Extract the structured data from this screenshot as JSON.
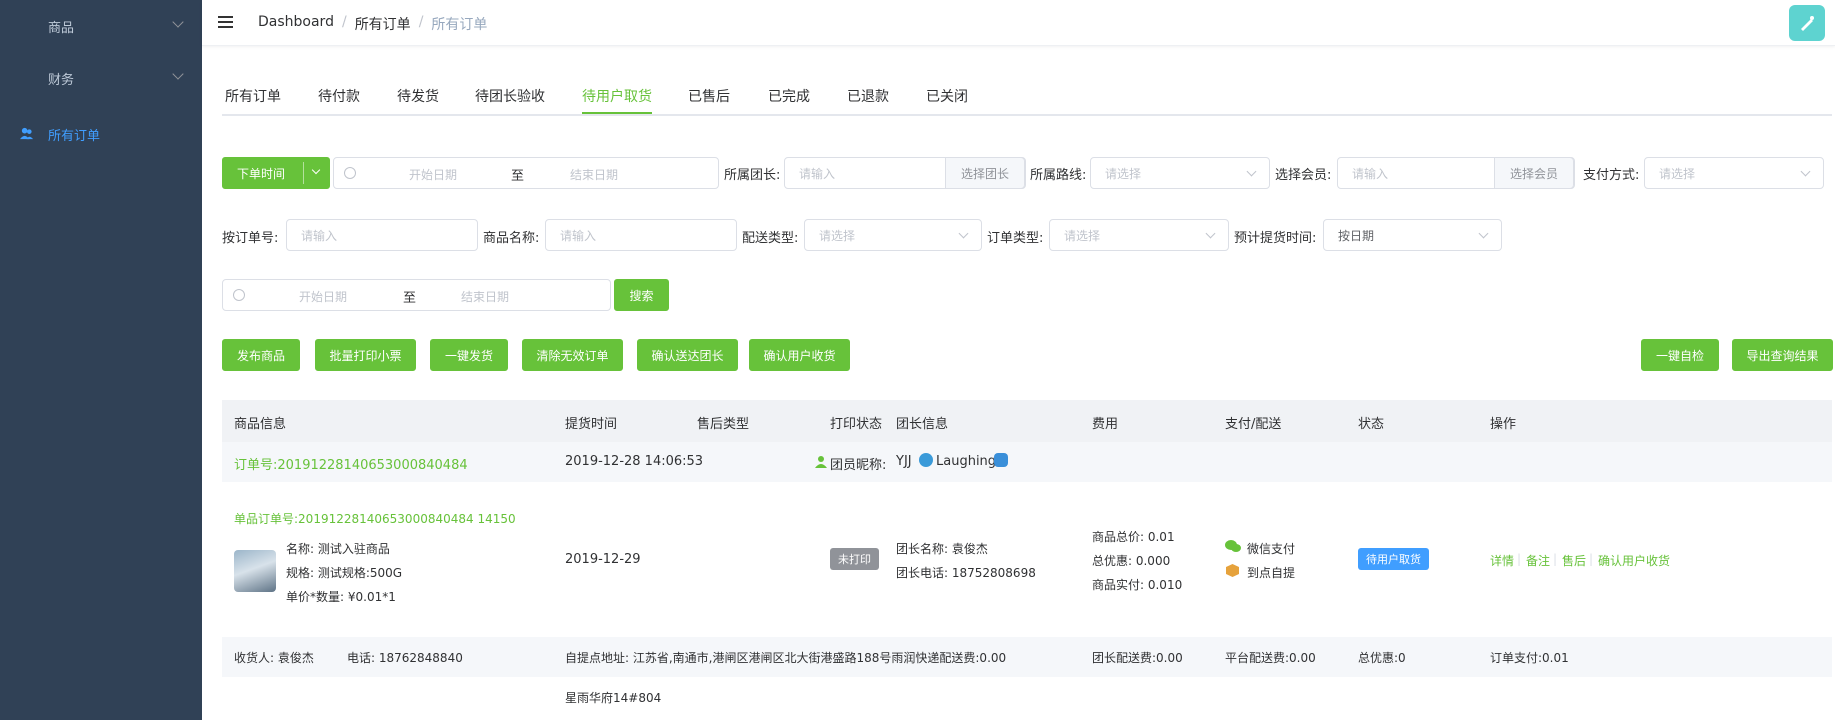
{
  "sidebar": {
    "items": [
      {
        "label": "商品"
      },
      {
        "label": "财务"
      },
      {
        "label": "所有订单"
      }
    ]
  },
  "breadcrumb": [
    "Dashboard",
    "所有订单",
    "所有订单"
  ],
  "tabs": [
    "所有订单",
    "待付款",
    "待发货",
    "待团长验收",
    "待用户取货",
    "已售后",
    "已完成",
    "已退款",
    "已关闭"
  ],
  "filters": {
    "order_time_label": "下单时间",
    "start_date": "开始日期",
    "end_date": "结束日期",
    "range_sep": "至",
    "leader_label": "所属团长:",
    "leader_placeholder": "请输入",
    "leader_btn": "选择团长",
    "route_label": "所属路线:",
    "route_placeholder": "请选择",
    "member_label": "选择会员:",
    "member_placeholder": "请输入",
    "member_btn": "选择会员",
    "pay_label": "支付方式:",
    "pay_placeholder": "请选择",
    "order_no_label": "按订单号:",
    "order_no_placeholder": "请输入",
    "goods_label": "商品名称:",
    "goods_placeholder": "请输入",
    "delivery_label": "配送类型:",
    "delivery_placeholder": "请选择",
    "order_type_label": "订单类型:",
    "order_type_placeholder": "请选择",
    "pickup_label": "预计提货时间:",
    "pickup_value": "按日期",
    "start_date2": "开始日期",
    "end_date2": "结束日期",
    "range_sep2": "至",
    "search_btn": "搜索"
  },
  "actions": {
    "left": [
      "发布商品",
      "批量打印小票",
      "一键发货",
      "清除无效订单",
      "确认送达团长",
      "确认用户收货"
    ],
    "right": [
      "一键自检",
      "导出查询结果"
    ]
  },
  "table": {
    "headers": [
      "商品信息",
      "提货时间",
      "售后类型",
      "打印状态",
      "团长信息",
      "费用",
      "支付/配送",
      "状态",
      "操作"
    ],
    "order": {
      "order_no": "订单号:20191228140653000840484",
      "time": "2019-12-28 14:06:53",
      "nickname_label": "团员昵称:",
      "nickname": "YJJ",
      "nickname_name": "Laughing"
    },
    "item": {
      "sub_order_no": "单品订单号:20191228140653000840484 14150",
      "name": "名称: 测试入驻商品",
      "spec": "规格: 测试规格:500G",
      "price_qty": "单价*数量: ¥0.01*1",
      "pickup_time": "2019-12-29",
      "print_status": "未打印",
      "leader_name": "团长名称: 袁俊杰",
      "leader_phone": "团长电话: 18752808698",
      "goods_total": "商品总价: 0.01",
      "discount": "总优惠: 0.000",
      "paid": "商品实付: 0.010",
      "pay_method": "微信支付",
      "delivery_method": "到点自提",
      "status": "待用户取货",
      "ops": [
        "详情",
        "备注",
        "售后",
        "确认用户收货"
      ]
    },
    "receiver": {
      "name": "收货人: 袁俊杰",
      "phone": "电话: 18762848840",
      "address": "自提点地址: 江苏省,南通市,港闸区港闸区北大街港盛路188号雨润快递配送费:0.00",
      "address2": "星雨华府14#804",
      "leader_fee": "团长配送费:0.00",
      "platform_fee": "平台配送费:0.00",
      "total_discount": "总优惠:0",
      "order_pay": "订单支付:0.01"
    }
  },
  "colors": {
    "sidebar_bg": "#304156",
    "primary_green": "#67c23a",
    "status_blue": "#409eff"
  }
}
